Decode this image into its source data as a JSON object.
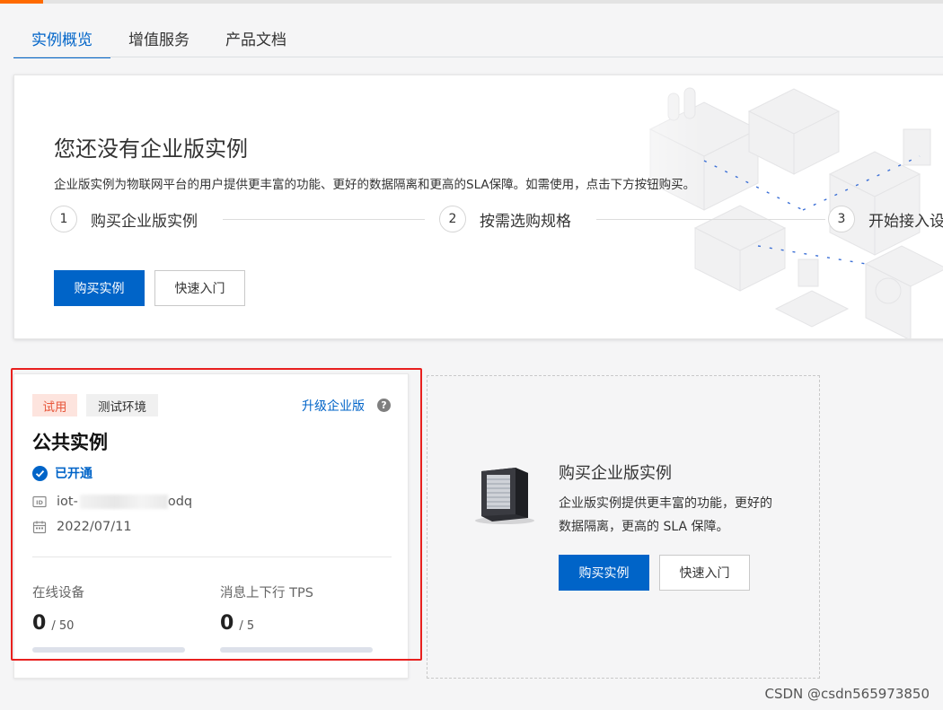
{
  "tabs": [
    {
      "label": "实例概览",
      "active": true
    },
    {
      "label": "增值服务",
      "active": false
    },
    {
      "label": "产品文档",
      "active": false
    }
  ],
  "banner": {
    "title": "您还没有企业版实例",
    "description": "企业版实例为物联网平台的用户提供更丰富的功能、更好的数据隔离和更高的SLA保障。如需使用，点击下方按钮购买。",
    "steps": [
      {
        "num": "1",
        "label": "购买企业版实例"
      },
      {
        "num": "2",
        "label": "按需选购规格"
      },
      {
        "num": "3",
        "label": "开始接入设"
      }
    ],
    "buy_label": "购买实例",
    "quickstart_label": "快速入门"
  },
  "instance_card": {
    "tag_trial": "试用",
    "tag_env": "测试环境",
    "upgrade_label": "升级企业版",
    "help_icon": "?",
    "title": "公共实例",
    "status": "已开通",
    "id_prefix": "iot-",
    "id_suffix": "odq",
    "date": "2022/07/11",
    "stats": [
      {
        "label": "在线设备",
        "value": "0",
        "max": "/ 50",
        "fraction": 0
      },
      {
        "label": "消息上下行 TPS",
        "value": "0",
        "max": "/ 5",
        "fraction": 0
      }
    ]
  },
  "promo": {
    "title": "购买企业版实例",
    "description": "企业版实例提供更丰富的功能，更好的数据隔离，更高的 SLA 保障。",
    "buy_label": "购买实例",
    "quickstart_label": "快速入门"
  },
  "watermark": "CSDN @csdn565973850",
  "colors": {
    "accent": "#0064c8",
    "trial": "#e8593d",
    "highlight_box": "#e8201e",
    "brand_orange": "#ff6a00"
  }
}
